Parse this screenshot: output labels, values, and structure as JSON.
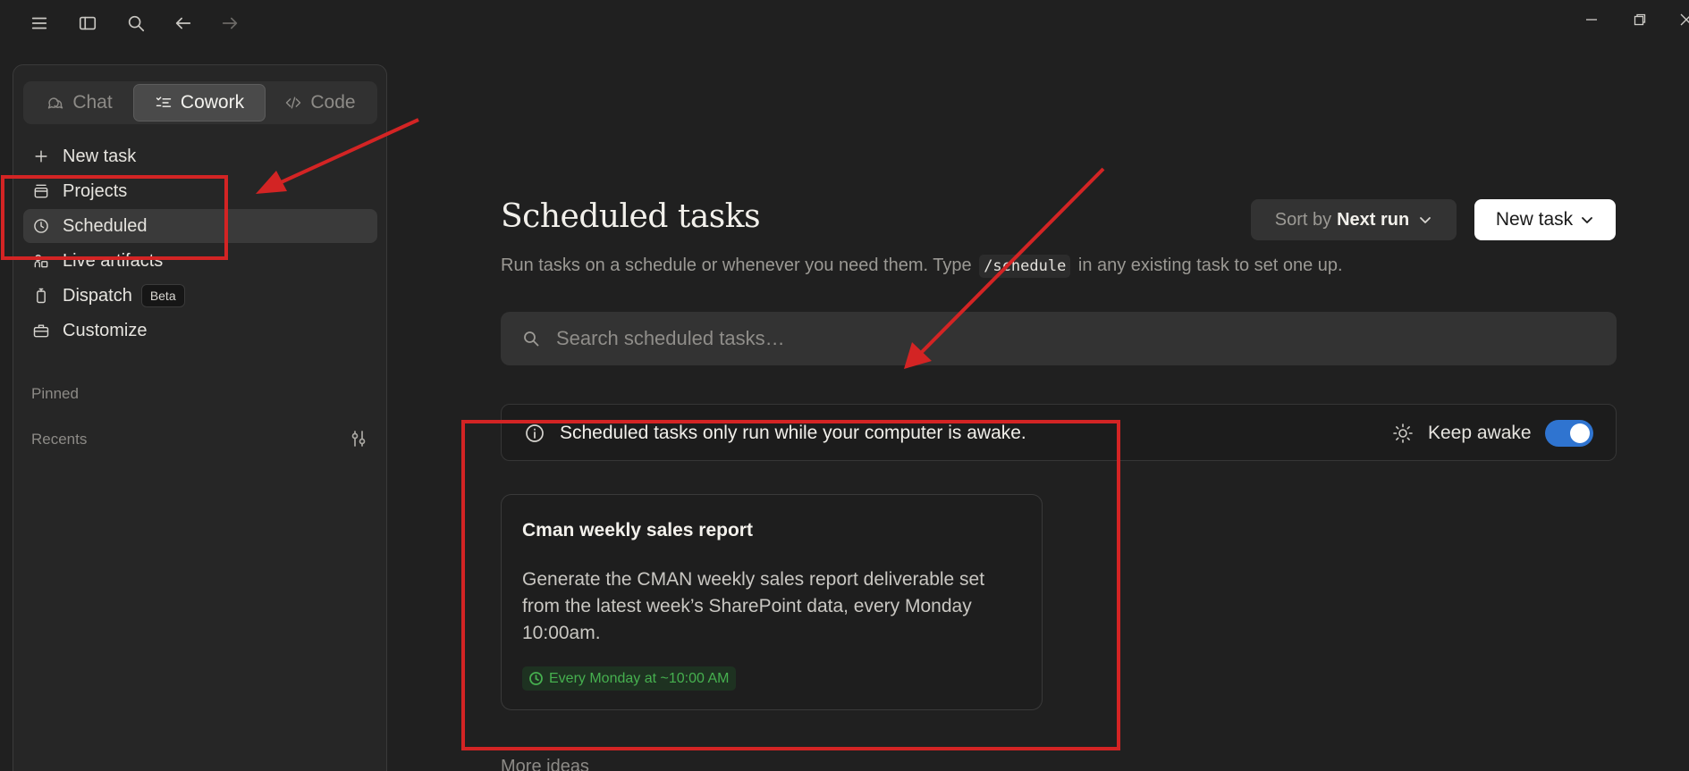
{
  "topbar": {
    "menu_icon": "hamburger-icon",
    "sidebar_toggle_icon": "sidebar-panel-icon",
    "search_icon": "search-icon",
    "back_icon": "arrow-left-icon",
    "forward_icon": "arrow-right-icon"
  },
  "sidebar": {
    "modes": [
      {
        "label": "Chat",
        "icon": "chat-bubbles-icon",
        "active": false
      },
      {
        "label": "Cowork",
        "icon": "checklist-icon",
        "active": true
      },
      {
        "label": "Code",
        "icon": "code-brackets-icon",
        "active": false
      }
    ],
    "items": [
      {
        "label": "New task",
        "icon": "plus-icon"
      },
      {
        "label": "Projects",
        "icon": "box-icon"
      },
      {
        "label": "Scheduled",
        "icon": "clock-icon",
        "active": true
      },
      {
        "label": "Live artifacts",
        "icon": "shapes-icon"
      },
      {
        "label": "Dispatch",
        "icon": "phone-icon",
        "badge": "Beta"
      },
      {
        "label": "Customize",
        "icon": "briefcase-icon"
      }
    ],
    "pinned_label": "Pinned",
    "recents_label": "Recents"
  },
  "main": {
    "title": "Scheduled tasks",
    "subtitle_before": "Run tasks on a schedule or whenever you need them. Type",
    "subtitle_code": "/schedule",
    "subtitle_after": "in any existing task to set one up.",
    "sort": {
      "prefix": "Sort by",
      "value": "Next run"
    },
    "new_task_label": "New task",
    "search_placeholder": "Search scheduled tasks…",
    "notice": {
      "text": "Scheduled tasks only run while your computer is awake.",
      "keep_awake_label": "Keep awake",
      "keep_awake_on": true
    },
    "task_card": {
      "title": "Cman weekly sales report",
      "description": "Generate the CMAN weekly sales report deliverable set from the latest week’s SharePoint data, every Monday 10:00am.",
      "schedule": "Every Monday at ~10:00 AM"
    },
    "more_ideas_label": "More ideas"
  },
  "colors": {
    "background": "#202020",
    "sidebar": "#262626",
    "accent_toggle": "#2f74d0",
    "schedule_green": "#46b04f",
    "annotation_red": "#d32424"
  }
}
